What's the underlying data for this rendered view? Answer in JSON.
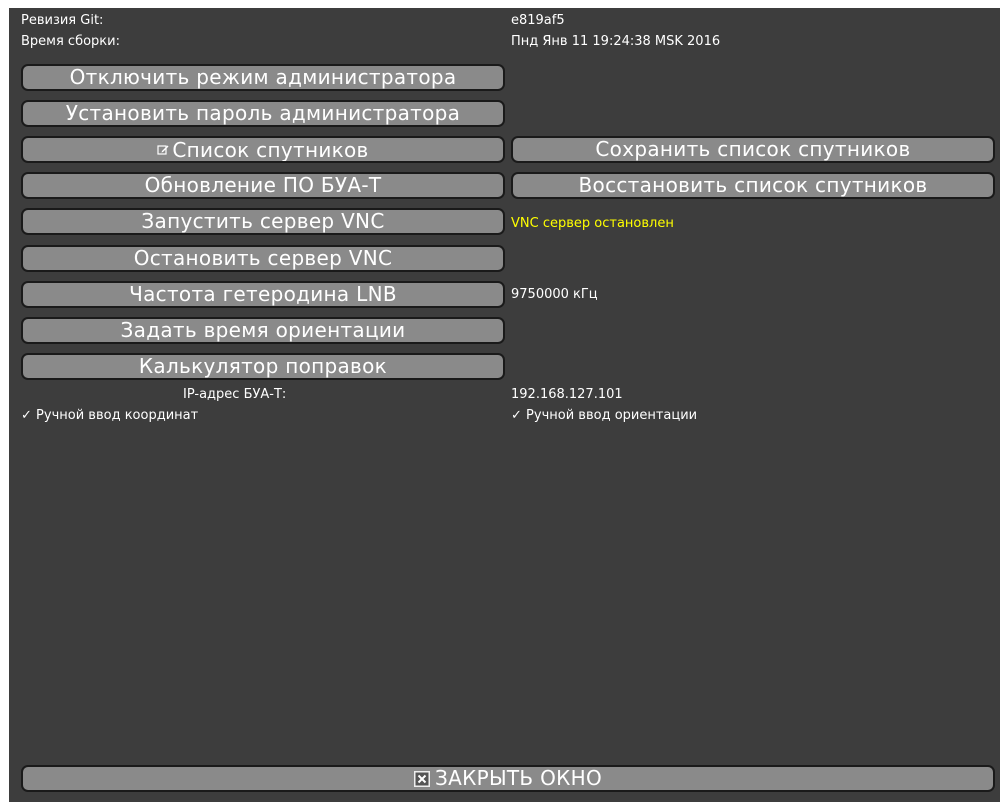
{
  "info": {
    "git_label": "Ревизия Git:",
    "git_value": "e819af5",
    "build_label": "Время сборки:",
    "build_value": "Пнд Янв 11 19:24:38 MSK 2016",
    "vnc_status": "VNC сервер остановлен",
    "lnb_value": "9750000 кГц",
    "ip_label": "IP-адрес БУА-Т:",
    "ip_value": "192.168.127.101"
  },
  "buttons": {
    "disable_admin": "Отключить режим администратора",
    "set_admin_password": "Установить пароль администратора",
    "satellite_list": "Список спутников",
    "save_satellite_list": "Сохранить список спутников",
    "firmware_update": "Обновление ПО БУА-Т",
    "restore_satellite_list": "Восстановить список спутников",
    "start_vnc": "Запустить сервер VNC",
    "stop_vnc": "Остановить сервер VNC",
    "lnb_frequency": "Частота гетеродина LNB",
    "set_orientation_time": "Задать время ориентации",
    "correction_calculator": "Калькулятор поправок",
    "close_window": "ЗАКРЫТЬ ОКНО"
  },
  "checkboxes": {
    "manual_coords": {
      "label": "Ручной ввод координат",
      "checked": true,
      "mark": "✓"
    },
    "manual_orientation": {
      "label": "Ручной ввод ориентации",
      "checked": true,
      "mark": "✓"
    }
  },
  "colors": {
    "background": "#3d3d3d",
    "button_fill": "#8a8a8a",
    "status_text": "#ffff00"
  },
  "icons": {
    "edit": "edit-icon",
    "close": "close-icon"
  }
}
